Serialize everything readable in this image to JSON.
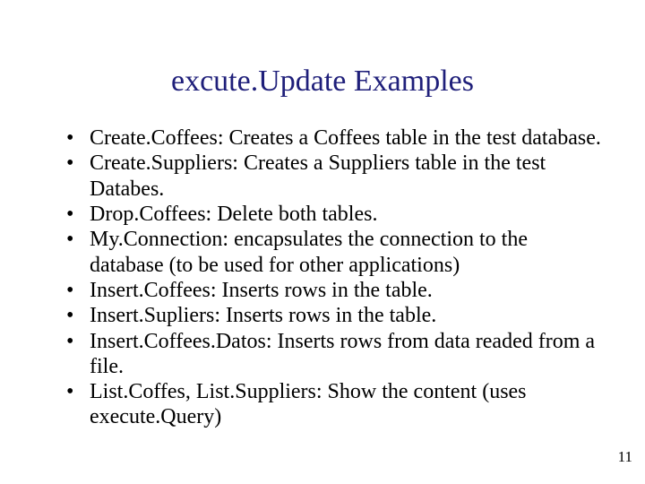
{
  "title": "excute.Update Examples",
  "bullets": [
    "Create.Coffees: Creates a Coffees table in the test database.",
    "Create.Suppliers: Creates a Suppliers table in the test Databes.",
    "Drop.Coffees: Delete both tables.",
    "My.Connection: encapsulates the connection to the database (to be used for other applications)",
    "Insert.Coffees: Inserts rows in the table.",
    "Insert.Supliers: Inserts rows in the table.",
    "Insert.Coffees.Datos: Inserts rows from data readed from a file.",
    "List.Coffes, List.Suppliers: Show the content (uses execute.Query)"
  ],
  "page_number": "11"
}
